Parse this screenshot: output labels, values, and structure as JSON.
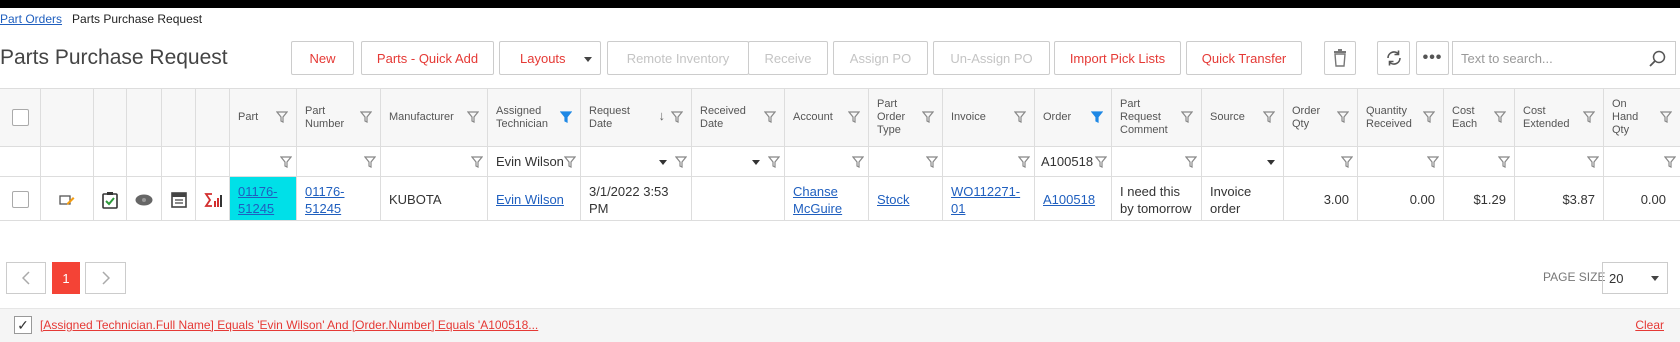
{
  "breadcrumb": {
    "parent": "Part Orders",
    "current": "Parts Purchase Request"
  },
  "page_title": "Parts Purchase Request",
  "toolbar": {
    "new": "New",
    "quick_add": "Parts - Quick Add",
    "layouts": "Layouts",
    "remote_inventory": "Remote Inventory",
    "receive": "Receive",
    "assign_po": "Assign PO",
    "unassign_po": "Un-Assign PO",
    "import_pick_lists": "Import Pick Lists",
    "quick_transfer": "Quick Transfer"
  },
  "search": {
    "placeholder": "Text to search..."
  },
  "columns": {
    "part": "Part",
    "part_number": "Part Number",
    "manufacturer": "Manufacturer",
    "assigned_technician": "Assigned Technician",
    "request_date": "Request Date",
    "received_date": "Received Date",
    "account": "Account",
    "part_order_type": "Part Order Type",
    "invoice": "Invoice",
    "order": "Order",
    "part_request_comment": "Part Request Comment",
    "source": "Source",
    "order_qty": "Order Qty",
    "quantity_received": "Quantity Received",
    "cost_each": "Cost Each",
    "cost_extended": "Cost Extended",
    "on_hand_qty": "On Hand Qty"
  },
  "filters": {
    "assigned_technician": "Evin Wilson",
    "order": "A100518"
  },
  "row": {
    "part": "01176-51245",
    "part_number": "01176-51245",
    "manufacturer": "KUBOTA",
    "assigned_technician": "Evin Wilson",
    "request_date": "3/1/2022 3:53 PM",
    "received_date": "",
    "account": "Chanse McGuire",
    "part_order_type": "Stock",
    "invoice": "WO112271-01",
    "order": "A100518",
    "part_request_comment": "I need this by tomorrow",
    "source": "Invoice order",
    "order_qty": "3.00",
    "quantity_received": "0.00",
    "cost_each": "$1.29",
    "cost_extended": "$3.87",
    "on_hand_qty": "0.00"
  },
  "pager": {
    "current_page": "1",
    "page_size_label": "PAGE SIZE",
    "page_size": "20"
  },
  "filter_bar": {
    "expression": "[Assigned Technician.Full Name] Equals 'Evin Wilson' And [Order.Number] Equals 'A100518...",
    "clear": "Clear"
  },
  "colors": {
    "accent": "#e53935",
    "link": "#1f5fbf",
    "highlight": "#00e0e8",
    "filter_active": "#1e88e5"
  }
}
